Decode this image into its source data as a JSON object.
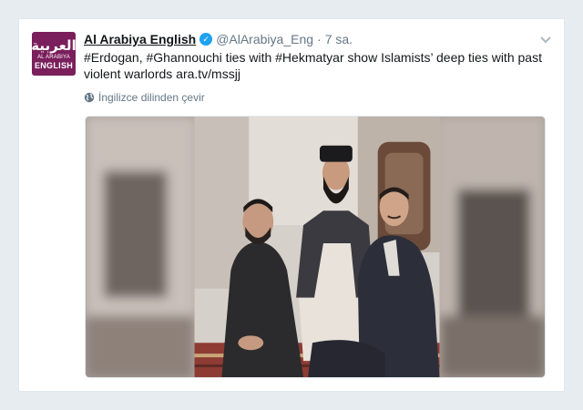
{
  "tweet": {
    "display_name": "Al Arabiya English",
    "handle": "@AlArabiya_Eng",
    "separator": "·",
    "time": "7 sa.",
    "text": "#Erdogan, #Ghannouchi ties with #Hekmatyar show Islamists’ deep ties with past violent warlords ara.tv/mssjj",
    "translate_label": "İngilizce dilinden çevir",
    "avatar": {
      "arabic": "العربية",
      "line1": "AL ARABIYA",
      "line2": "ENGLISH",
      "color": "#7a1f5c"
    },
    "verified_icon": "check-icon"
  },
  "colors": {
    "page_bg": "#e6ecf0",
    "card_bg": "#ffffff",
    "text_primary": "#14171a",
    "text_secondary": "#657786",
    "verified_blue": "#1da1f2"
  },
  "icons": {
    "menu": "chevron-down-icon",
    "translate": "globe-icon"
  }
}
